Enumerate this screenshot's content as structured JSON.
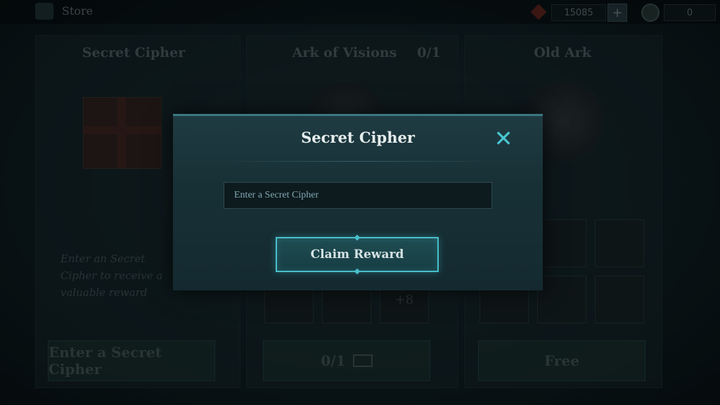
{
  "background": {
    "store_title": "Store",
    "currency_amount": "15085",
    "coin_amount": "0",
    "plus_label": "+",
    "tabs": [
      {
        "title": "Secret Cipher"
      },
      {
        "title": "Ark of Visions",
        "count": "0/1"
      },
      {
        "title": "Old Ark"
      }
    ],
    "description": "Enter an Secret Cipher to receive a valuable reward",
    "slot_badge": "+8",
    "buttons": {
      "enter": "Enter a Secret Cipher",
      "ark": "0/1",
      "free": "Free"
    }
  },
  "modal": {
    "title": "Secret Cipher",
    "close_glyph": "✕",
    "input_placeholder": "Enter a Secret Cipher",
    "input_value": "",
    "claim_label": "Claim Reward"
  },
  "colors": {
    "accent": "#49c6d4",
    "modal_bg": "#173036"
  },
  "icons": [
    "store-icon",
    "gem-icon",
    "coin-icon",
    "close-icon",
    "video-icon"
  ]
}
